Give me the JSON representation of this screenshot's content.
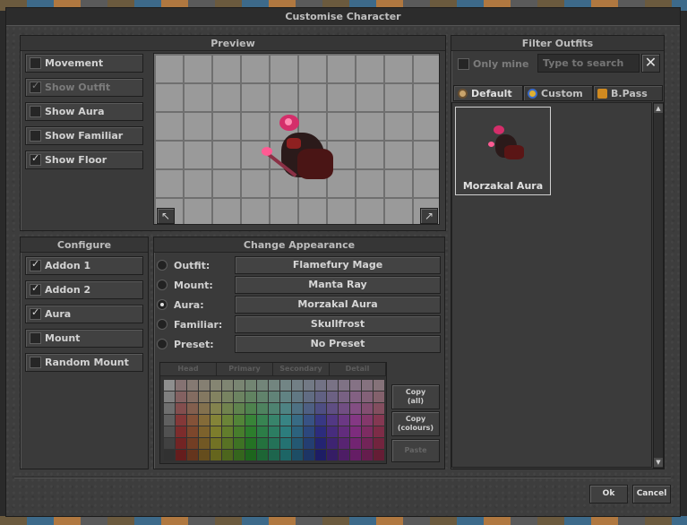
{
  "window": {
    "title": "Customise Character"
  },
  "preview": {
    "title": "Preview",
    "options": [
      {
        "label": "Movement",
        "checked": false,
        "disabled": false
      },
      {
        "label": "Show Outfit",
        "checked": true,
        "disabled": true
      },
      {
        "label": "Show Aura",
        "checked": false,
        "disabled": false
      },
      {
        "label": "Show Familiar",
        "checked": false,
        "disabled": false
      },
      {
        "label": "Show Floor",
        "checked": true,
        "disabled": false
      }
    ],
    "rotate_left_icon": "↖",
    "rotate_right_icon": "↗"
  },
  "filter": {
    "title": "Filter Outfits",
    "only_mine_label": "Only mine",
    "search_placeholder": "Type to search",
    "clear_icon": "✕",
    "tabs": [
      {
        "label": "Default",
        "icon_color": "#c9a46c",
        "active": true
      },
      {
        "label": "Custom",
        "icon_color": "#e0b030",
        "active": false
      },
      {
        "label": "B.Pass",
        "icon_color": "#d08a20",
        "active": false
      }
    ],
    "outfits": [
      {
        "name": "Morzakal Aura",
        "selected": true
      }
    ]
  },
  "configure": {
    "title": "Configure",
    "options": [
      {
        "label": "Addon 1",
        "checked": true
      },
      {
        "label": "Addon 2",
        "checked": true
      },
      {
        "label": "Aura",
        "checked": true
      },
      {
        "label": "Mount",
        "checked": false
      },
      {
        "label": "Random Mount",
        "checked": false
      }
    ]
  },
  "appearance": {
    "title": "Change Appearance",
    "rows": [
      {
        "label": "Outfit:",
        "value": "Flamefury Mage",
        "selected": false
      },
      {
        "label": "Mount:",
        "value": "Manta Ray",
        "selected": false
      },
      {
        "label": "Aura:",
        "value": "Morzakal Aura",
        "selected": true
      },
      {
        "label": "Familiar:",
        "value": "Skullfrost",
        "selected": false
      },
      {
        "label": "Preset:",
        "value": "No Preset",
        "selected": false
      }
    ],
    "palette_tabs": [
      "Head",
      "Primary",
      "Secondary",
      "Detail"
    ],
    "copy_all_label": [
      "Copy",
      "(all)"
    ],
    "copy_colours_label": [
      "Copy",
      "(colours)"
    ],
    "paste_label": "Paste"
  },
  "footer": {
    "ok_label": "Ok",
    "cancel_label": "Cancel"
  }
}
